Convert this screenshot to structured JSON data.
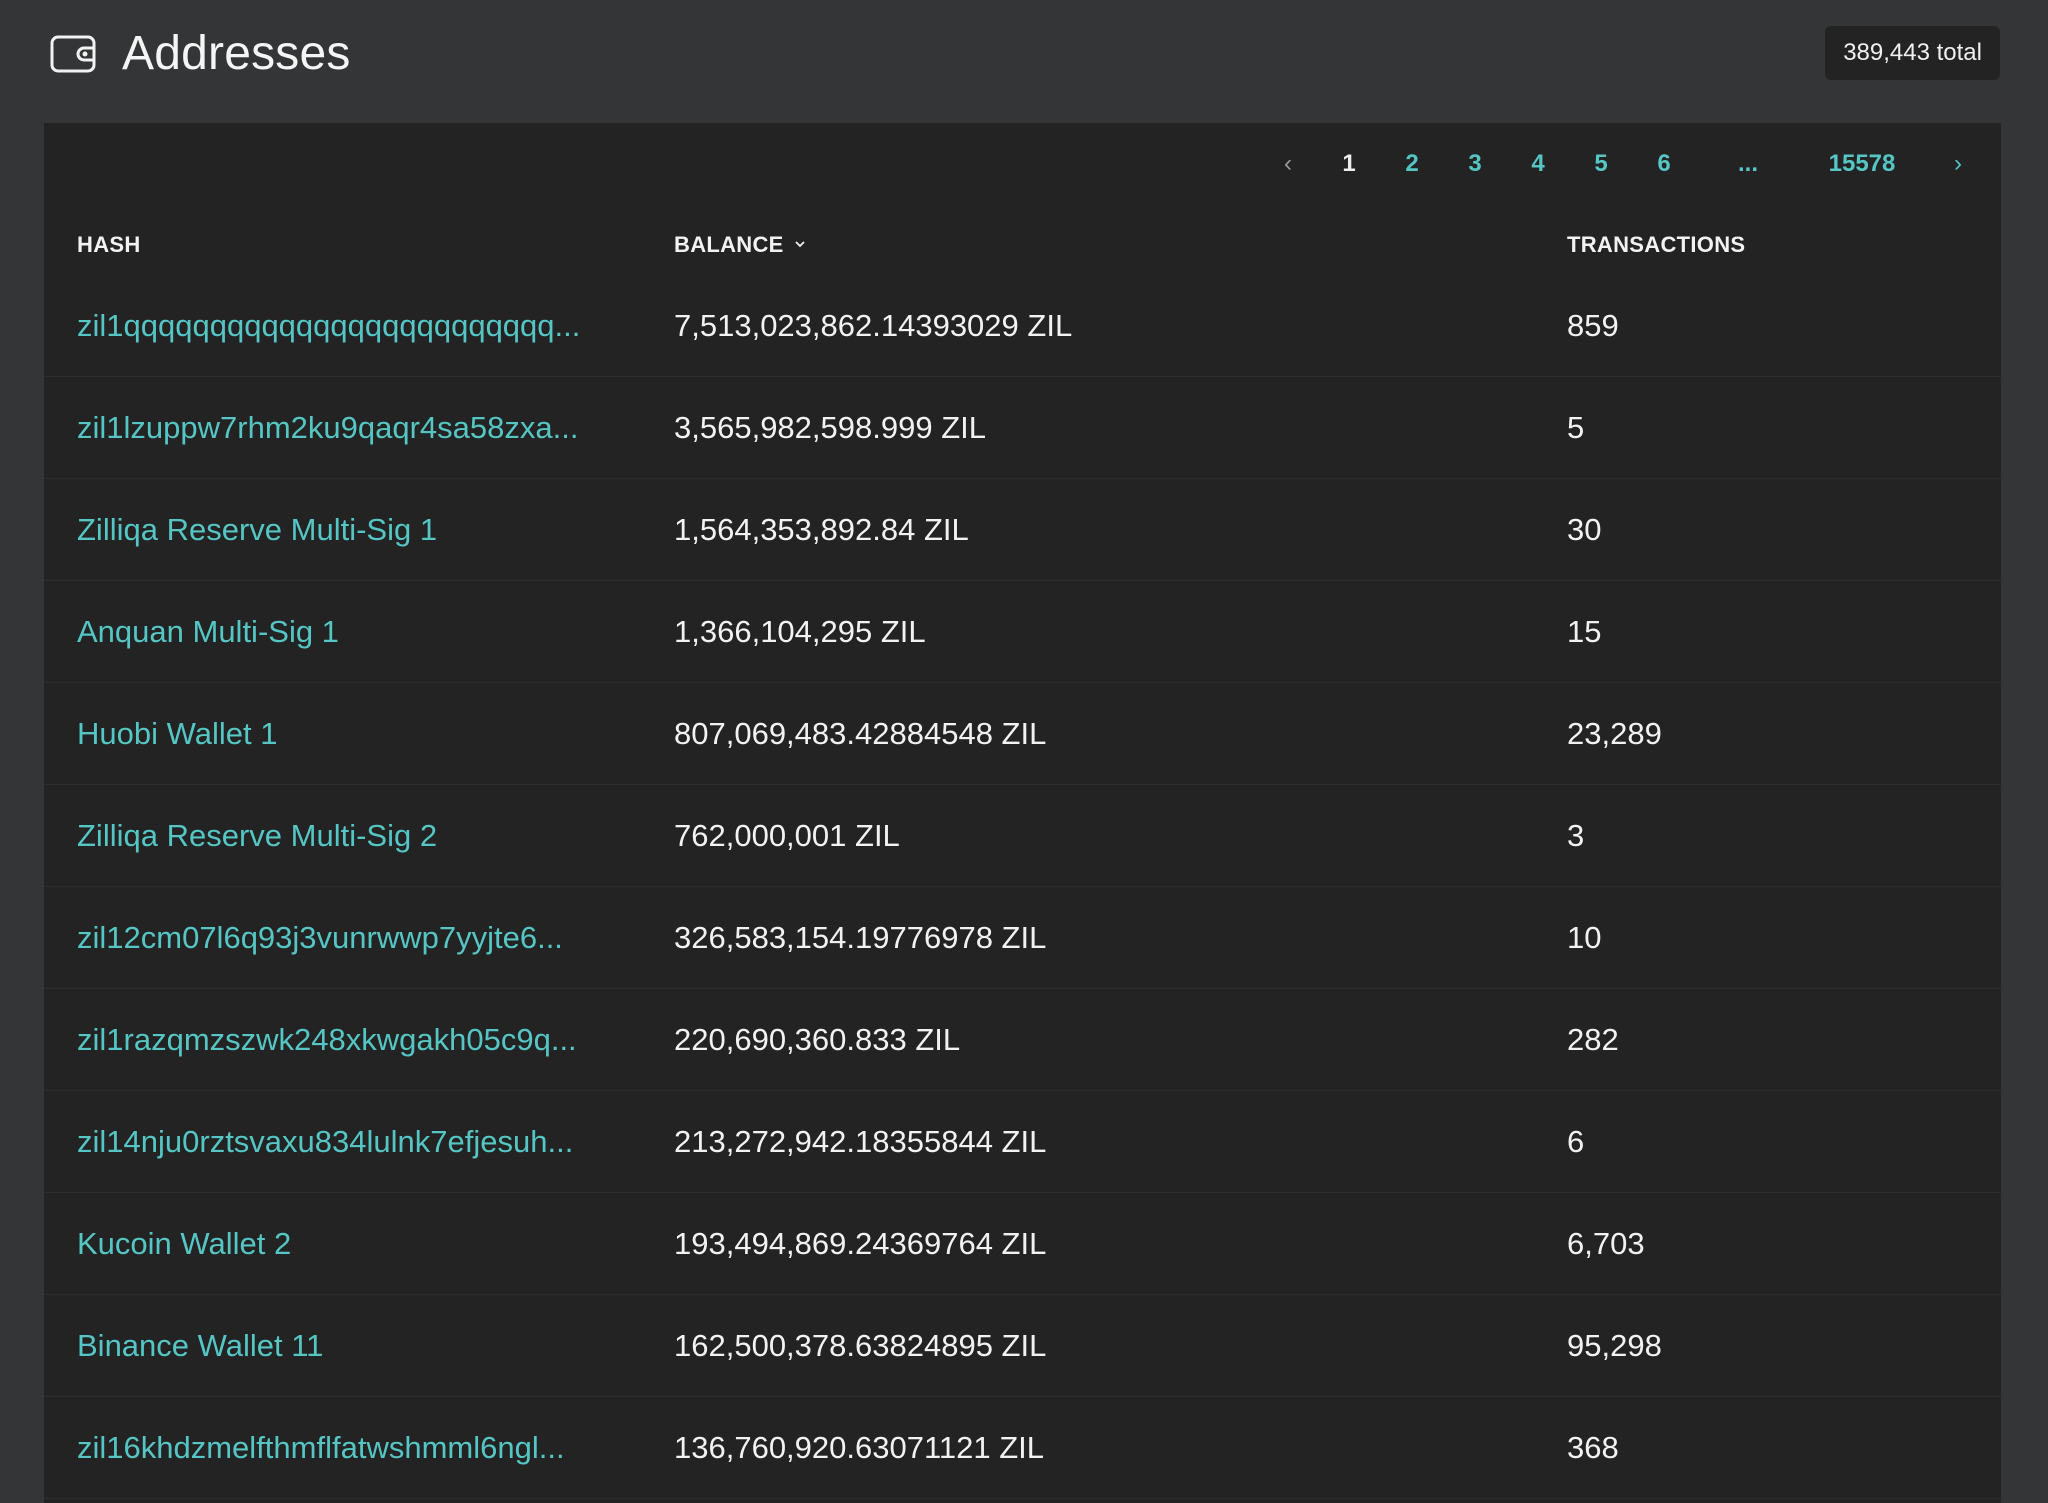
{
  "header": {
    "title": "Addresses",
    "icon": "wallet-icon",
    "total_label": "389,443 total"
  },
  "colors": {
    "background": "#333536",
    "panel": "#232323",
    "link": "#55c6c4",
    "text": "#f2f2f2"
  },
  "pagination": {
    "prev_label": "‹",
    "next_label": "›",
    "pages": [
      {
        "label": "1",
        "current": true
      },
      {
        "label": "2",
        "current": false
      },
      {
        "label": "3",
        "current": false
      },
      {
        "label": "4",
        "current": false
      },
      {
        "label": "5",
        "current": false
      },
      {
        "label": "6",
        "current": false
      }
    ],
    "ellipsis": "...",
    "last_page": "15578"
  },
  "table": {
    "columns": {
      "hash": "HASH",
      "balance": "BALANCE",
      "transactions": "TRANSACTIONS"
    },
    "sort_icon": "chevron-down-icon",
    "rows": [
      {
        "hash": "zil1qqqqqqqqqqqqqqqqqqqqqqqqq...",
        "balance": "7,513,023,862.14393029 ZIL",
        "transactions": "859"
      },
      {
        "hash": "zil1lzuppw7rhm2ku9qaqr4sa58zxa...",
        "balance": "3,565,982,598.999 ZIL",
        "transactions": "5"
      },
      {
        "hash": "Zilliqa Reserve Multi-Sig 1",
        "balance": "1,564,353,892.84 ZIL",
        "transactions": "30"
      },
      {
        "hash": "Anquan Multi-Sig 1",
        "balance": "1,366,104,295 ZIL",
        "transactions": "15"
      },
      {
        "hash": "Huobi Wallet 1",
        "balance": "807,069,483.42884548 ZIL",
        "transactions": "23,289"
      },
      {
        "hash": "Zilliqa Reserve Multi-Sig 2",
        "balance": "762,000,001 ZIL",
        "transactions": "3"
      },
      {
        "hash": "zil12cm07l6q93j3vunrwwp7yyjte6...",
        "balance": "326,583,154.19776978 ZIL",
        "transactions": "10"
      },
      {
        "hash": "zil1razqmzszwk248xkwgakh05c9q...",
        "balance": "220,690,360.833 ZIL",
        "transactions": "282"
      },
      {
        "hash": "zil14nju0rztsvaxu834lulnk7efjesuh...",
        "balance": "213,272,942.18355844 ZIL",
        "transactions": "6"
      },
      {
        "hash": "Kucoin Wallet 2",
        "balance": "193,494,869.24369764 ZIL",
        "transactions": "6,703"
      },
      {
        "hash": "Binance Wallet 11",
        "balance": "162,500,378.63824895 ZIL",
        "transactions": "95,298"
      },
      {
        "hash": "zil16khdzmelfthmflfatwshmml6ngl...",
        "balance": "136,760,920.63071121 ZIL",
        "transactions": "368"
      }
    ]
  }
}
